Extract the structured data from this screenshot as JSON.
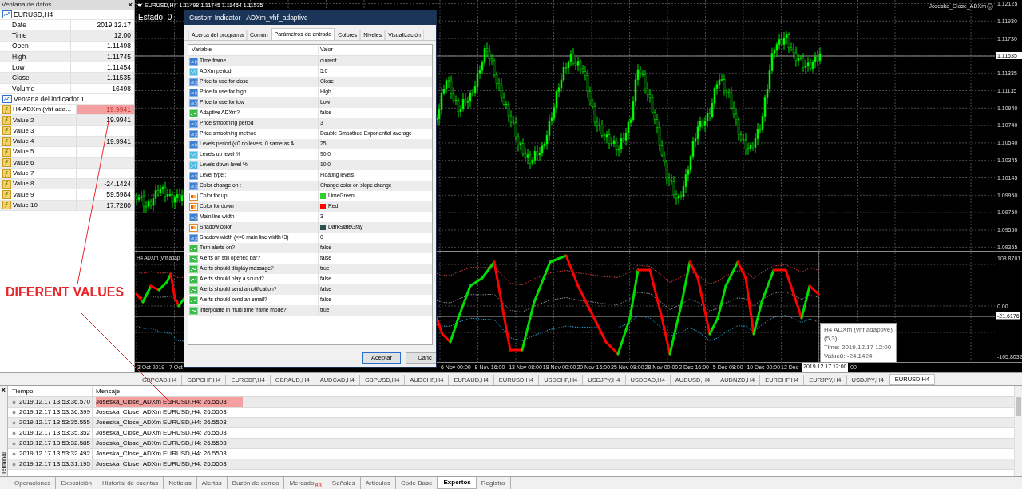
{
  "data_window": {
    "title": "Ventana de datos",
    "close": "×",
    "symbol": "EURUSD,H4",
    "rows": [
      {
        "label": "Date",
        "value": "2019.12.17"
      },
      {
        "label": "Time",
        "value": "12:00"
      },
      {
        "label": "Open",
        "value": "1.11498"
      },
      {
        "label": "High",
        "value": "1.11745"
      },
      {
        "label": "Low",
        "value": "1.11454"
      },
      {
        "label": "Close",
        "value": "1.11535"
      },
      {
        "label": "Volume",
        "value": "16498"
      }
    ],
    "indicator_section": "Ventana del indicador 1",
    "indicator_rows": [
      {
        "label": "H4 ADXm (vhf ada...",
        "value": "19.9941",
        "highlighted": true
      },
      {
        "label": "Value 2",
        "value": "19.9941",
        "highlighted": false
      },
      {
        "label": "Value 3"
      },
      {
        "label": "Value 4",
        "value": "19.9941",
        "highlighted": false
      },
      {
        "label": "Value 5"
      },
      {
        "label": "Value 6"
      },
      {
        "label": "Value 7"
      },
      {
        "label": "Value 8",
        "value": "-24.1424",
        "highlighted": false
      },
      {
        "label": "Value 9",
        "value": "59.5984",
        "highlighted": false
      },
      {
        "label": "Value 10",
        "value": "17.7280",
        "highlighted": false
      }
    ]
  },
  "annotation": {
    "text": "DIFERENT VALUES"
  },
  "chart": {
    "symbol": "EURUSD,H4",
    "ohlc": "1.11498 1.11745 1.11454 1.11535",
    "status": "Estado: 0",
    "expert": "Joseska_Close_ADXm",
    "indicator_label": "H4 ADXm (vhf adap",
    "price_axis": [
      {
        "label": "1.12125",
        "current": false
      },
      {
        "label": "1.11930",
        "current": false
      },
      {
        "label": "1.11730",
        "current": false
      },
      {
        "label": "1.11535",
        "current": true
      },
      {
        "label": "1.11335",
        "current": false
      },
      {
        "label": "1.11135",
        "current": false
      },
      {
        "label": "1.10940",
        "current": false
      },
      {
        "label": "1.10740",
        "current": false
      },
      {
        "label": "1.10540",
        "current": false
      },
      {
        "label": "1.10345",
        "current": false
      },
      {
        "label": "1.10145",
        "current": false
      },
      {
        "label": "1.09950",
        "current": false
      },
      {
        "label": "1.09750",
        "current": false
      },
      {
        "label": "1.09550",
        "current": false
      },
      {
        "label": "1.09355",
        "current": false
      }
    ],
    "indicator_axis": [
      {
        "label": "108.8701",
        "current": false
      },
      {
        "label": "0.00",
        "current": false
      },
      {
        "label": "-21.6176",
        "current": true
      },
      {
        "label": "-105.8032",
        "current": false
      }
    ],
    "time_axis_left": [
      "3 Oct 2019",
      "7 Oct"
    ],
    "time_axis_right": [
      "6 Nov 00:00",
      "8 Nov 16:00",
      "13 Nov 08:00",
      "18 Nov 00:00",
      "20 Nov 16:00",
      "25 Nov 08:00",
      "28 Nov 00:00",
      "2 Dec 16:00",
      "5 Dec 08:00",
      "10 Dec 00:00",
      "12 Dec"
    ],
    "time_cursor": "2019.12.17 12:00",
    "time_tail": "00",
    "tooltip": [
      "H4 ADXm (vhf adaptive)",
      "(5,3)",
      "Time: 2019.12.17 12:00",
      "Value8: -24.1424"
    ]
  },
  "dialog": {
    "title": "Custom Indicator - ADXm_vhf_adaptive",
    "tabs": [
      {
        "label": "Acerca del programa",
        "selected": false
      },
      {
        "label": "Común",
        "selected": false
      },
      {
        "label": "Parámetros de entrada",
        "selected": true
      },
      {
        "label": "Colores",
        "selected": false
      },
      {
        "label": "Niveles",
        "selected": false
      },
      {
        "label": "Visualización",
        "selected": false
      }
    ],
    "columns": [
      "Variable",
      "Valor"
    ],
    "parameters": [
      {
        "kind": "int",
        "name": "Time frame",
        "value": "current"
      },
      {
        "kind": "double",
        "name": "ADXm period",
        "value": "5.0"
      },
      {
        "kind": "int",
        "name": "Price to use for close",
        "value": "Close"
      },
      {
        "kind": "int",
        "name": "Price to use for high",
        "value": "High"
      },
      {
        "kind": "int",
        "name": "Price to use for low",
        "value": "Low"
      },
      {
        "kind": "bool",
        "name": "Adaptive ADXm?",
        "value": "false"
      },
      {
        "kind": "int",
        "name": "Price smoothing period",
        "value": "3"
      },
      {
        "kind": "int",
        "name": "Price smoothing method",
        "value": "Double Smoothed Exponential average"
      },
      {
        "kind": "int",
        "name": "Levels period (<0 no levels, 0 same as A...",
        "value": "25"
      },
      {
        "kind": "double",
        "name": "Levels up level %",
        "value": "90.0"
      },
      {
        "kind": "double",
        "name": "Levels down level %",
        "value": "10.0"
      },
      {
        "kind": "int",
        "name": "Level type :",
        "value": "Floating levels"
      },
      {
        "kind": "int",
        "name": "Color change on :",
        "value": "Change color on slope change"
      },
      {
        "kind": "color",
        "name": "Color for up",
        "value": "LimeGreen",
        "color": "#32cd32"
      },
      {
        "kind": "color",
        "name": "Color for down",
        "value": "Red",
        "color": "#ff0000"
      },
      {
        "kind": "int",
        "name": "Main line width",
        "value": "3"
      },
      {
        "kind": "color",
        "name": "Shadow color",
        "value": "DarkSlateGray",
        "color": "#2f4f4f"
      },
      {
        "kind": "int",
        "name": "Shadow width (<=0 main line width+3)",
        "value": "0"
      },
      {
        "kind": "bool",
        "name": "Turn alerts on?",
        "value": "false"
      },
      {
        "kind": "bool",
        "name": "Alerts on still opened bar?",
        "value": "false"
      },
      {
        "kind": "bool",
        "name": "Alerts should display message?",
        "value": "true"
      },
      {
        "kind": "bool",
        "name": "Alerts should play a sound?",
        "value": "false"
      },
      {
        "kind": "bool",
        "name": "Alerts should send a notification?",
        "value": "false"
      },
      {
        "kind": "bool",
        "name": "Alerts should send an email?",
        "value": "false"
      },
      {
        "kind": "bool",
        "name": "Interpolate in multi time frame mode?",
        "value": "true"
      }
    ],
    "buttons": [
      {
        "label": "Aceptar",
        "default": true
      },
      {
        "label": "Canc",
        "default": false
      }
    ]
  },
  "chart_tabs": [
    {
      "label": "GBPCAD,H4",
      "selected": false
    },
    {
      "label": "GBPCHF,H4",
      "selected": false
    },
    {
      "label": "EURGBP,H4",
      "selected": false
    },
    {
      "label": "GBPAUD,H4",
      "selected": false
    },
    {
      "label": "AUDCAD,H4",
      "selected": false
    },
    {
      "label": "GBPUSD,H4",
      "selected": false
    },
    {
      "label": "AUDCHF,H4",
      "selected": false
    },
    {
      "label": "EURAUD,H4",
      "selected": false
    },
    {
      "label": "EURUSD,H4",
      "selected": false
    },
    {
      "label": "USDCHF,H4",
      "selected": false
    },
    {
      "label": "USDJPY,H4",
      "selected": false
    },
    {
      "label": "USDCAD,H4",
      "selected": false
    },
    {
      "label": "AUDUSD,H4",
      "selected": false
    },
    {
      "label": "AUDNZD,H4",
      "selected": false
    },
    {
      "label": "EURCHF,H4",
      "selected": false
    },
    {
      "label": "EURJPY,H4",
      "selected": false
    },
    {
      "label": "USDJPY,H4",
      "selected": false
    },
    {
      "label": "EURUSD,H4",
      "selected": true
    }
  ],
  "terminal": {
    "title": "Terminal",
    "close": "×",
    "columns": [
      "Tiempo",
      "Mensaje"
    ],
    "rows": [
      {
        "time": "2019.12.17 13:53:36.570",
        "message": "Joseska_Close_ADXm EURUSD,H4: 26.5503",
        "highlighted": true
      },
      {
        "time": "2019.12.17 13:53:36.399",
        "message": "Joseska_Close_ADXm EURUSD,H4: 26.5503",
        "highlighted": false
      },
      {
        "time": "2019.12.17 13:53:35.555",
        "message": "Joseska_Close_ADXm EURUSD,H4: 26.5503",
        "highlighted": false
      },
      {
        "time": "2019.12.17 13:53:35.352",
        "message": "Joseska_Close_ADXm EURUSD,H4: 26.5503",
        "highlighted": false
      },
      {
        "time": "2019.12.17 13:53:32.585",
        "message": "Joseska_Close_ADXm EURUSD,H4: 26.5503",
        "highlighted": false
      },
      {
        "time": "2019.12.17 13:53:32.492",
        "message": "Joseska_Close_ADXm EURUSD,H4: 26.5503",
        "highlighted": false
      },
      {
        "time": "2019.12.17 13:53:31.195",
        "message": "Joseska_Close_ADXm EURUSD,H4: 26.5503",
        "highlighted": false
      }
    ],
    "tabs": [
      {
        "label": "Operaciones",
        "selected": false
      },
      {
        "label": "Exposición",
        "selected": false
      },
      {
        "label": "Historial de cuentas",
        "selected": false
      },
      {
        "label": "Noticias",
        "selected": false
      },
      {
        "label": "Alertas",
        "selected": false
      },
      {
        "label": "Buzón de correo",
        "selected": false
      },
      {
        "label": "Mercado",
        "selected": false,
        "badge": "83"
      },
      {
        "label": "Señales",
        "selected": false
      },
      {
        "label": "Artículos",
        "selected": false
      },
      {
        "label": "Code Base",
        "selected": false
      },
      {
        "label": "Expertos",
        "selected": true
      },
      {
        "label": "Registro",
        "selected": false
      }
    ]
  }
}
